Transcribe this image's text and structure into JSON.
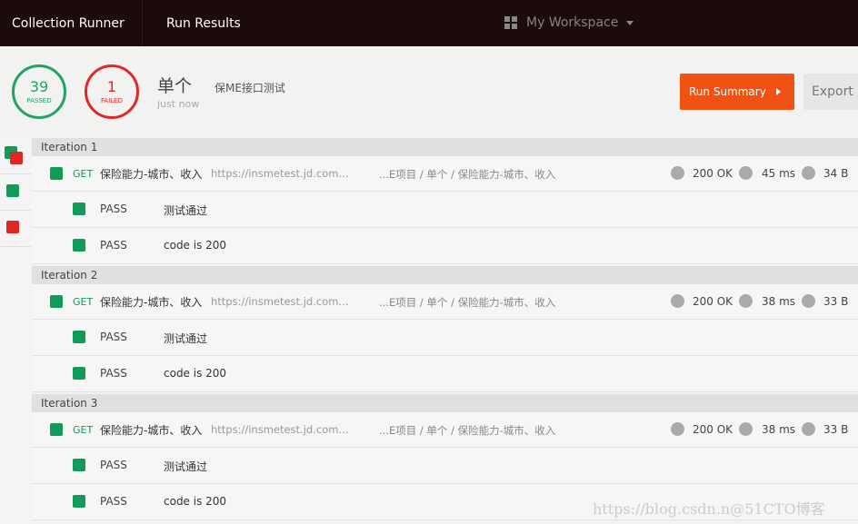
{
  "header": {
    "tabs": [
      "Collection Runner",
      "Run Results"
    ],
    "workspace": "My Workspace"
  },
  "summary": {
    "passed": "39",
    "passed_label": "PASSED",
    "failed": "1",
    "failed_label": "FAILED",
    "title": "单个",
    "time": "just now",
    "collection": "保ME接口测试",
    "run_summary": "Run Summary",
    "export": "Export R"
  },
  "sidebar": [
    {
      "status": "mixed"
    },
    {
      "status": "pass"
    },
    {
      "status": "fail"
    }
  ],
  "colors": {
    "pass": "#119b59",
    "fail": "#e02525",
    "accent": "#ef5213",
    "header": "#1c0b0b"
  },
  "iterations": [
    {
      "label": "Iteration 1",
      "request": {
        "method": "GET",
        "name": "保险能力-城市、收入",
        "url": "https://insmetest.jd.com...",
        "path": "...E项目 / 单个 / 保险能力-城市、收入",
        "status": "200 OK",
        "time": "45 ms",
        "size": "34 B"
      },
      "tests": [
        {
          "result": "PASS",
          "name": "测试通过"
        },
        {
          "result": "PASS",
          "name": "code is 200"
        }
      ]
    },
    {
      "label": "Iteration 2",
      "request": {
        "method": "GET",
        "name": "保险能力-城市、收入",
        "url": "https://insmetest.jd.com...",
        "path": "...E项目 / 单个 / 保险能力-城市、收入",
        "status": "200 OK",
        "time": "38 ms",
        "size": "33 B"
      },
      "tests": [
        {
          "result": "PASS",
          "name": "测试通过"
        },
        {
          "result": "PASS",
          "name": "code is 200"
        }
      ]
    },
    {
      "label": "Iteration 3",
      "request": {
        "method": "GET",
        "name": "保险能力-城市、收入",
        "url": "https://insmetest.jd.com...",
        "path": "...E项目 / 单个 / 保险能力-城市、收入",
        "status": "200 OK",
        "time": "38 ms",
        "size": "33 B"
      },
      "tests": [
        {
          "result": "PASS",
          "name": "测试通过"
        },
        {
          "result": "PASS",
          "name": "code is 200"
        }
      ]
    }
  ],
  "watermark": "https://blog.csdn.n@51CTO博客"
}
